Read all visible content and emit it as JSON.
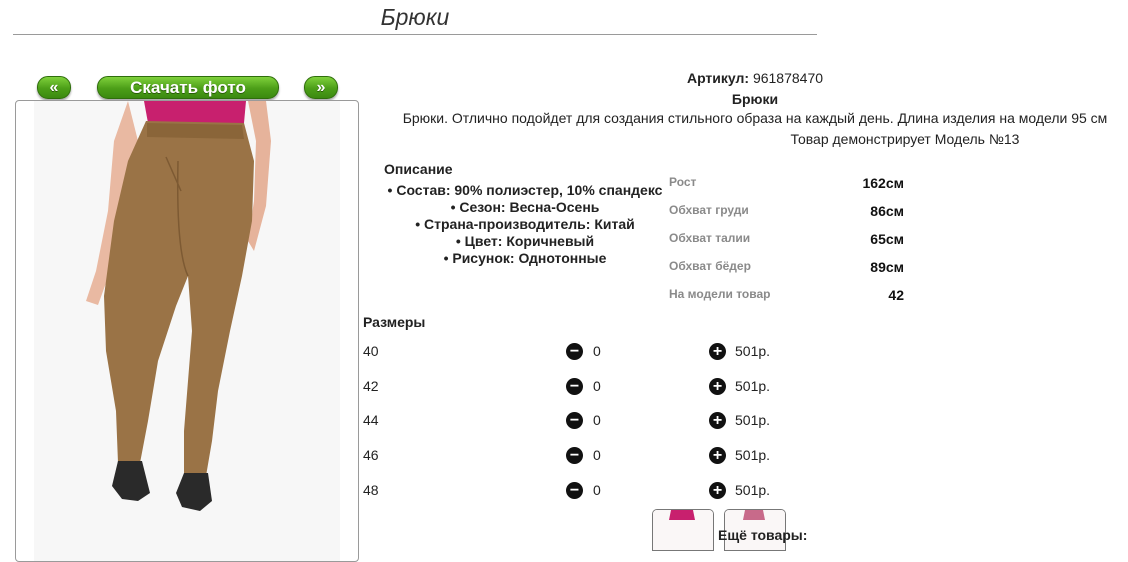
{
  "page": {
    "title": "Брюки"
  },
  "gallery": {
    "prev_label": "«",
    "download_label": "Скачать фото",
    "next_label": "»"
  },
  "product": {
    "article_label": "Артикул:",
    "article_value": "961878470",
    "name": "Брюки",
    "description": "Брюки. Отлично подойдет для создания стильного образа на каждый день. Длина изделия на модели 95 см",
    "model_note": "Товар демонстрирует Модель №13"
  },
  "details": {
    "heading": "Описание",
    "items": [
      "Состав: 90% полиэстер, 10% спандекс",
      "Сезон: Весна-Осень",
      "Страна-производитель: Китай",
      "Цвет: Коричневый",
      "Рисунок: Однотонные"
    ]
  },
  "measurements": [
    {
      "label": "Рост",
      "value": "162см"
    },
    {
      "label": "Обхват груди",
      "value": "86см"
    },
    {
      "label": "Обхват талии",
      "value": "65см"
    },
    {
      "label": "Обхват бёдер",
      "value": "89см"
    },
    {
      "label": "На модели товар",
      "value": "42"
    }
  ],
  "sizes": {
    "heading": "Размеры",
    "rows": [
      {
        "size": "40",
        "qty": "0",
        "price": "501р."
      },
      {
        "size": "42",
        "qty": "0",
        "price": "501р."
      },
      {
        "size": "44",
        "qty": "0",
        "price": "501р."
      },
      {
        "size": "46",
        "qty": "0",
        "price": "501р."
      },
      {
        "size": "48",
        "qty": "0",
        "price": "501р."
      }
    ]
  },
  "icons": {
    "minus": "minus-circle-icon",
    "plus": "plus-circle-icon"
  },
  "colors": {
    "button_green": "#5aae22",
    "pants_brown": "#9a7346",
    "top_pink": "#c8206e"
  },
  "more": {
    "heading": "Ещё товары:"
  }
}
